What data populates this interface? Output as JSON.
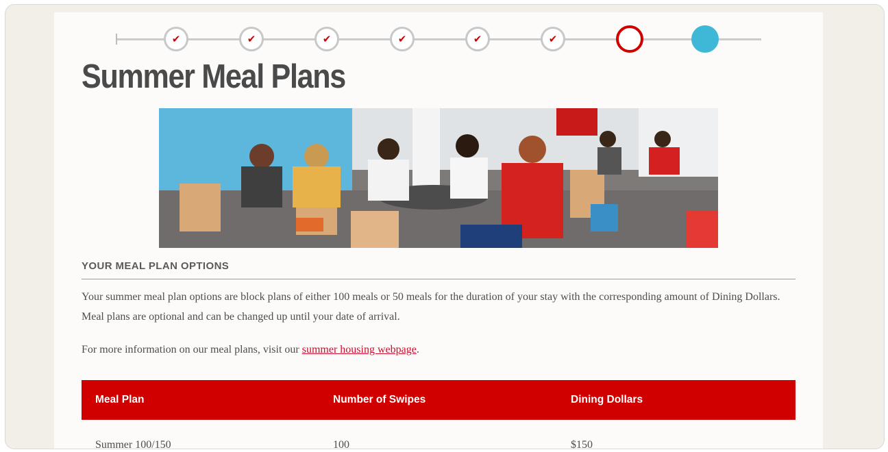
{
  "progress": {
    "steps": [
      {
        "state": "done",
        "symbol": "✔"
      },
      {
        "state": "done",
        "symbol": "✔"
      },
      {
        "state": "done",
        "symbol": "✔"
      },
      {
        "state": "done",
        "symbol": "✔"
      },
      {
        "state": "done",
        "symbol": "✔"
      },
      {
        "state": "done",
        "symbol": "✔"
      },
      {
        "state": "current"
      },
      {
        "state": "upcoming"
      }
    ],
    "colors": {
      "done_check": "#d00000",
      "current_ring": "#d00000",
      "upcoming_fill": "#3fb7d6",
      "track": "#cbcbcb"
    }
  },
  "page": {
    "title": "Summer Meal Plans",
    "hero_image": {
      "subject": "students dining in a cafeteria"
    },
    "section_title": "YOUR MEAL PLAN OPTIONS",
    "intro_text": "Your summer meal plan options are block plans of either 100 meals or 50 meals for the duration of your stay with the corresponding amount of Dining Dollars. Meal plans are optional and can be changed up until your date of arrival.",
    "more_info_prefix": "For more information on our meal plans, visit our ",
    "more_info_link": "summer housing webpage",
    "more_info_suffix": "."
  },
  "table": {
    "headers": [
      "Meal Plan",
      "Number of Swipes",
      "Dining Dollars"
    ],
    "rows": [
      [
        "Summer 100/150",
        "100",
        "$150"
      ]
    ],
    "header_color": "#d00000"
  }
}
